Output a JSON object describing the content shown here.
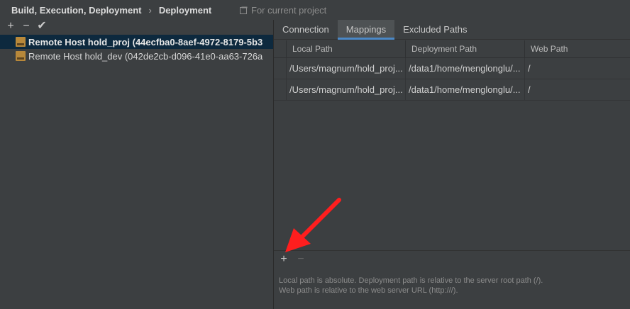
{
  "breadcrumb": {
    "items": [
      "Build, Execution, Deployment",
      "Deployment"
    ],
    "separator": "›"
  },
  "scope": {
    "label": "For current project",
    "icon": "project-scope-icon"
  },
  "left_toolbar": {
    "add": "+",
    "remove": "−",
    "apply": "✔"
  },
  "servers": [
    {
      "name": "Remote Host hold_proj (44ecfba0-8aef-4972-8179-5b3",
      "selected": true,
      "icon": "sftp-icon"
    },
    {
      "name": "Remote Host hold_dev (042de2cb-d096-41e0-aa63-726a",
      "selected": false,
      "icon": "sftp-icon"
    }
  ],
  "tabs": [
    {
      "label": "Connection",
      "active": false
    },
    {
      "label": "Mappings",
      "active": true
    },
    {
      "label": "Excluded Paths",
      "active": false
    }
  ],
  "table": {
    "columns": [
      "Local Path",
      "Deployment Path",
      "Web Path"
    ],
    "rows": [
      [
        "/Users/magnum/hold_proj...",
        "/data1/home/menglonglu/...",
        "/"
      ],
      [
        "/Users/magnum/hold_proj...",
        "/data1/home/menglonglu/...",
        "/"
      ]
    ]
  },
  "table_toolbar": {
    "add": "+",
    "remove": "−"
  },
  "hint": {
    "line1": "Local path is absolute. Deployment path is relative to the server root path (/).",
    "line2": "Web path is relative to the web server URL (http:///)."
  },
  "colors": {
    "background": "#3c3f41",
    "selection": "#0d293e",
    "tab_underline": "#4a88c7",
    "annotation_arrow": "#ff1e1e"
  }
}
